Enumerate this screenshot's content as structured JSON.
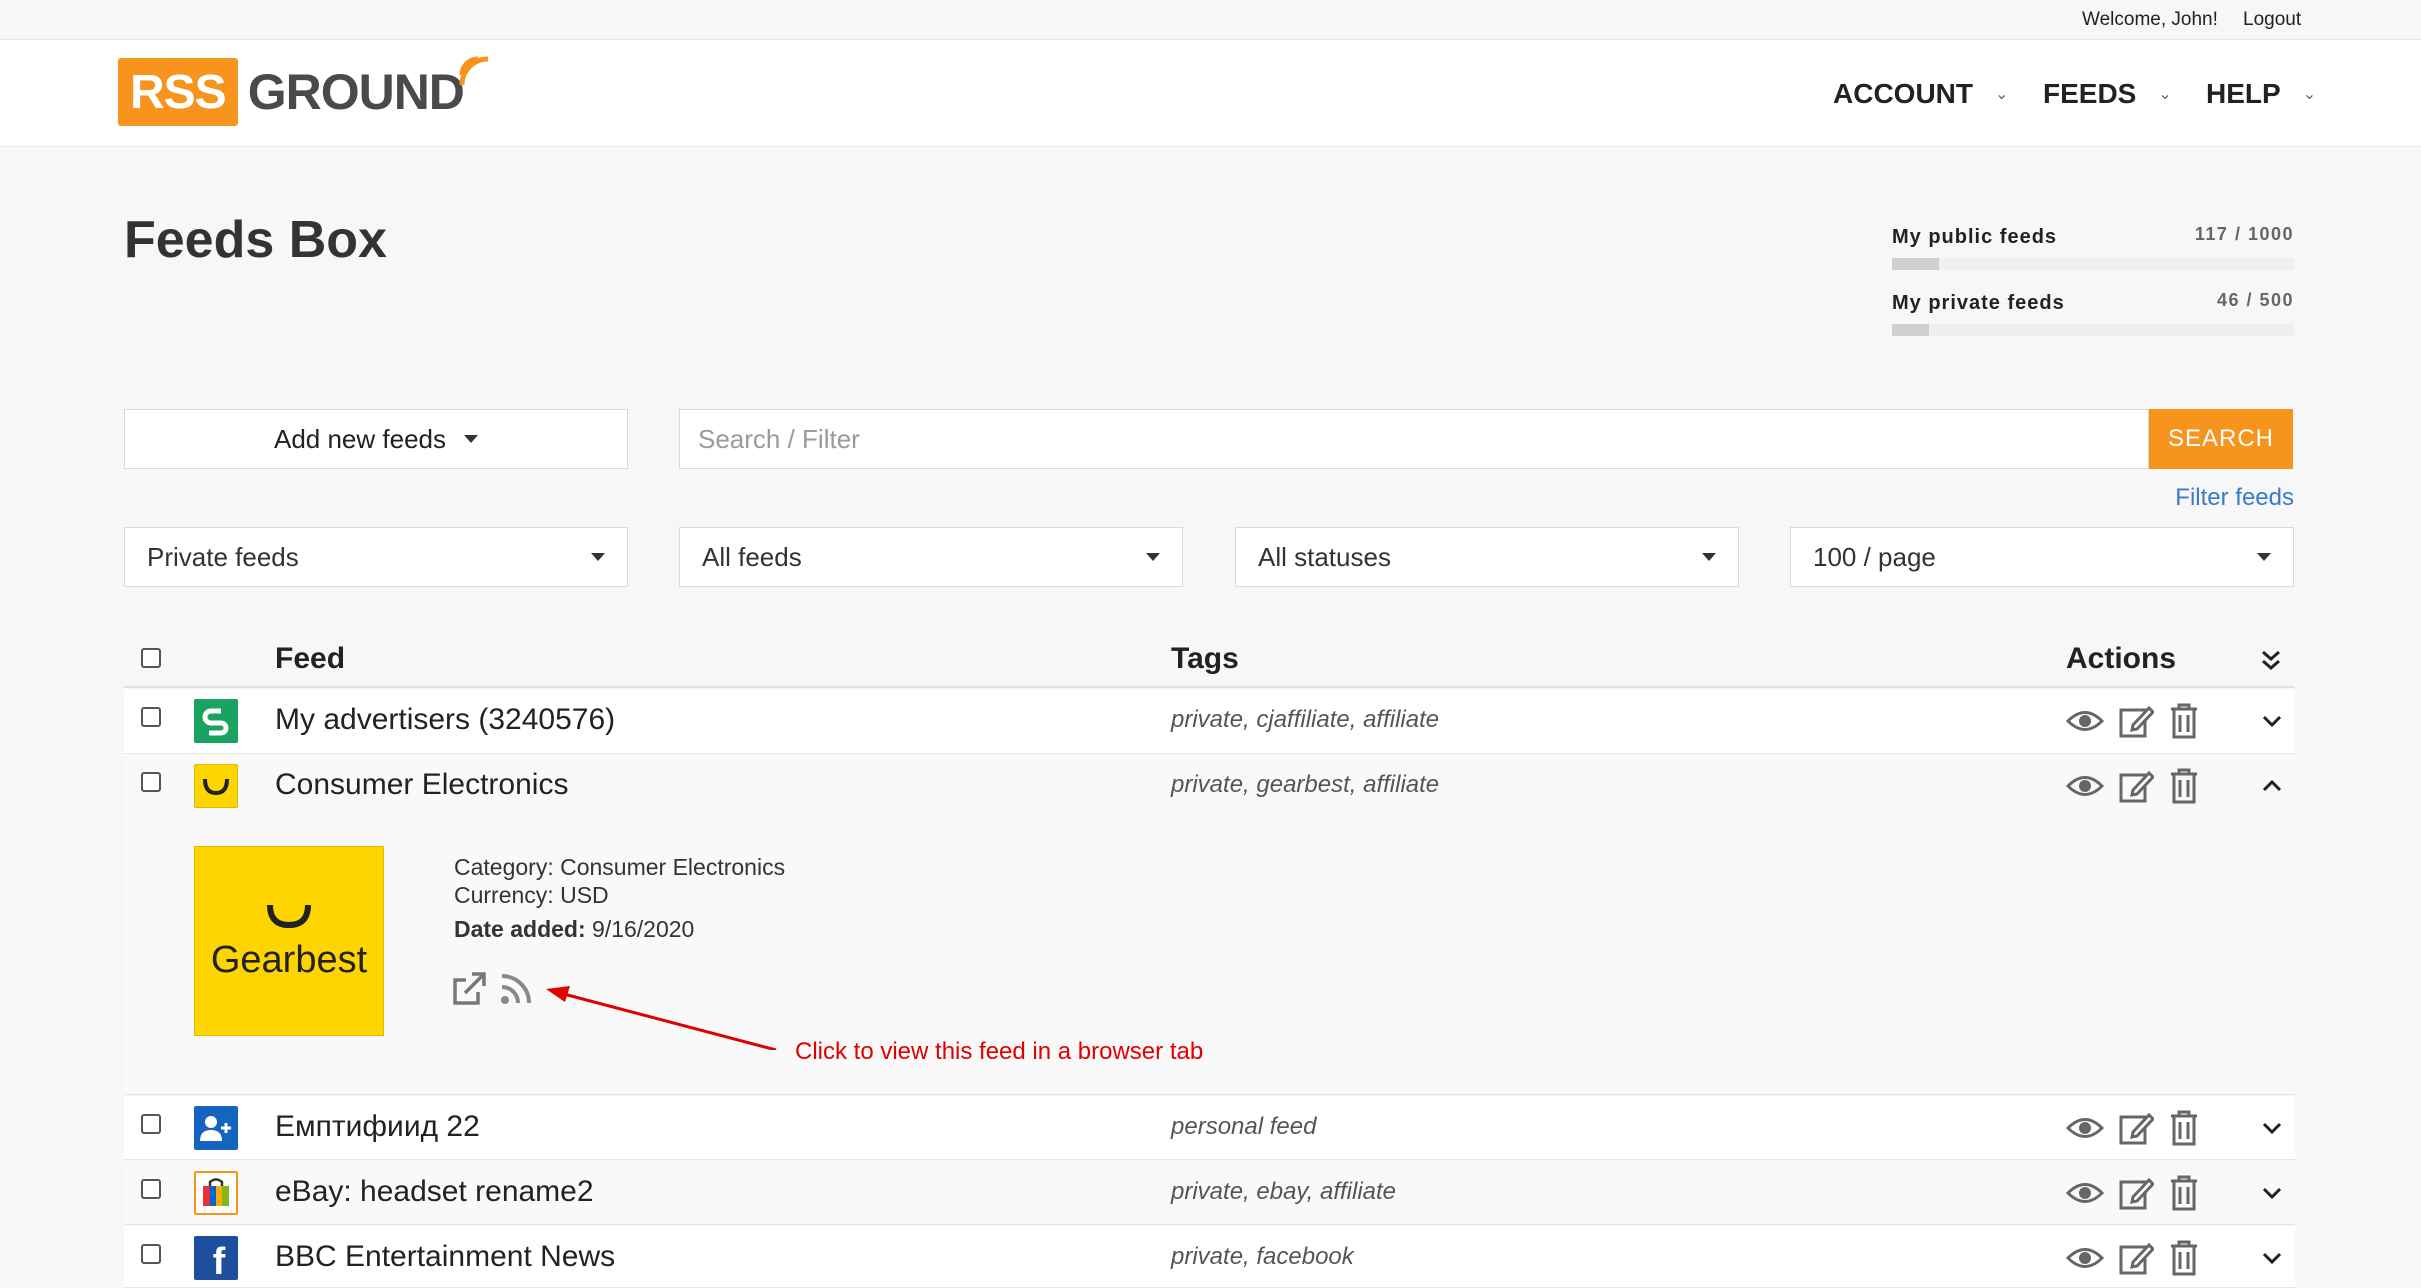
{
  "topbar": {
    "welcome": "Welcome, John!",
    "logout": "Logout"
  },
  "logo": {
    "part1": "RSS",
    "part2": "GROUND"
  },
  "nav": [
    {
      "label": "ACCOUNT"
    },
    {
      "label": "FEEDS"
    },
    {
      "label": "HELP"
    }
  ],
  "page": {
    "title": "Feeds Box"
  },
  "quotas": [
    {
      "label": "My public feeds",
      "count": "117 / 1000",
      "fraction": 0.117
    },
    {
      "label": "My private feeds",
      "count": "46 / 500",
      "fraction": 0.092
    }
  ],
  "controls": {
    "add_label": "Add new feeds",
    "search_placeholder": "Search / Filter",
    "search_button": "SEARCH",
    "filter_link": "Filter feeds",
    "selects": [
      "Private feeds",
      "All feeds",
      "All statuses",
      "100 / page"
    ]
  },
  "table": {
    "headers": {
      "feed": "Feed",
      "tags": "Tags",
      "actions": "Actions"
    },
    "rows": [
      {
        "name": "My advertisers (3240576)",
        "tags": "private, cjaffiliate, affiliate",
        "icon": "cj-affiliate-icon",
        "color": "#1aa260"
      },
      {
        "name": "Consumer Electronics",
        "tags": "private, gearbest, affiliate",
        "icon": "gearbest-icon",
        "color": "#ffd500",
        "expanded": true
      },
      {
        "name": "Емптифиид 22",
        "tags": "personal feed",
        "icon": "add-user-icon",
        "color": "#1565c0"
      },
      {
        "name": "eBay: headset rename2",
        "tags": "private, ebay, affiliate",
        "icon": "ebay-bag-icon",
        "color": "#f7941d"
      },
      {
        "name": "BBC Entertainment News",
        "tags": "private, facebook",
        "icon": "facebook-icon",
        "color": "#1e4f9c"
      }
    ]
  },
  "detail": {
    "brand": "Gearbest",
    "category": "Category: Consumer Electronics",
    "currency": "Currency: USD",
    "date_label": "Date added:",
    "date_value": "9/16/2020"
  },
  "annotation": {
    "text": "Click to view this feed in a browser tab"
  }
}
